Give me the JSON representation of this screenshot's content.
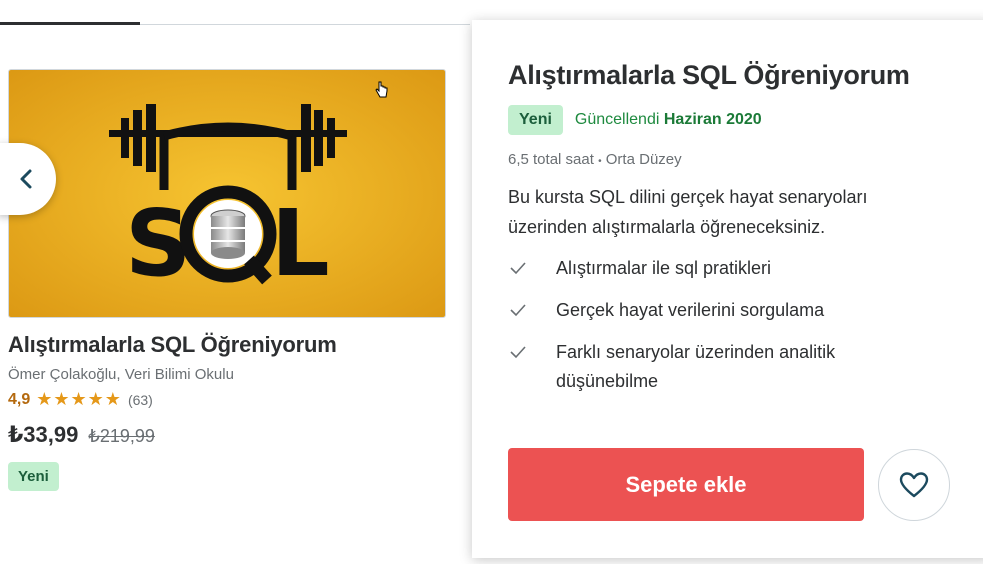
{
  "card": {
    "title": "Alıştırmalarla SQL Öğreniyorum",
    "instructors": "Ömer Çolakoğlu, Veri Bilimi Okulu",
    "rating": "4,9",
    "stars": "★★★★★",
    "rating_count": "(63)",
    "price_current": "₺33,99",
    "price_original": "₺219,99",
    "badge": "Yeni",
    "thumbnail_text": "SQL"
  },
  "popover": {
    "title": "Alıştırmalarla SQL Öğreniyorum",
    "badge": "Yeni",
    "updated_label": "Güncellendi",
    "updated_date": "Haziran 2020",
    "hours": "6,5 total saat",
    "separator": "•",
    "level": "Orta Düzey",
    "description": "Bu kursta SQL dilini gerçek hayat senaryoları üzerinden alıştırmalarla öğreneceksiniz.",
    "objectives": [
      "Alıştırmalar ile sql pratikleri",
      "Gerçek hayat verilerini sorgulama",
      "Farklı senaryolar üzerinden analitik düşünebilme"
    ],
    "add_to_cart": "Sepete ekle"
  },
  "icons": {
    "prev": "chevron-left-icon",
    "check": "check-icon",
    "wishlist": "heart-icon",
    "cursor": "hand-cursor-icon"
  },
  "colors": {
    "accent": "#ec5252",
    "badge_bg": "#c2efcf",
    "badge_text": "#1b5e3b",
    "rating": "#b4690e",
    "star": "#e59819",
    "updated": "#1e8a3f",
    "thumbnail_bg": "#e8a91c"
  }
}
